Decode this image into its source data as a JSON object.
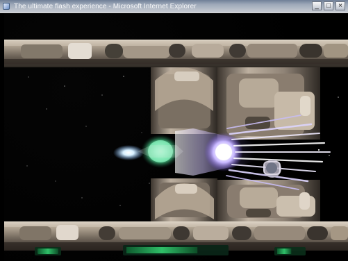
{
  "window": {
    "title": "The ultimate flash experience - Microsoft Internet Explorer",
    "controls": {
      "minimize": "_",
      "maximize": "□",
      "close": "×"
    }
  },
  "colors": {
    "hull": "#9d8f7e",
    "hull_dark": "#4f473d",
    "hull_light": "#d9d0c1",
    "hud_green": "#2fbf68",
    "engine_green": "#66d4a0",
    "plasma_core": "#ffffff",
    "plasma_violet": "#8c72d8",
    "shield_blue": "#cce7ff"
  },
  "icons": {
    "window": "browser-window-icon",
    "minimize": "minimize-icon",
    "maximize": "maximize-icon",
    "close": "close-icon",
    "player_ship": "player-ship-icon",
    "enemy": "enemy-drone-icon"
  },
  "hud": {
    "left_text": "",
    "center_text": "",
    "right_text": "",
    "shield_level": 0.72,
    "energy_level": 0.55
  }
}
